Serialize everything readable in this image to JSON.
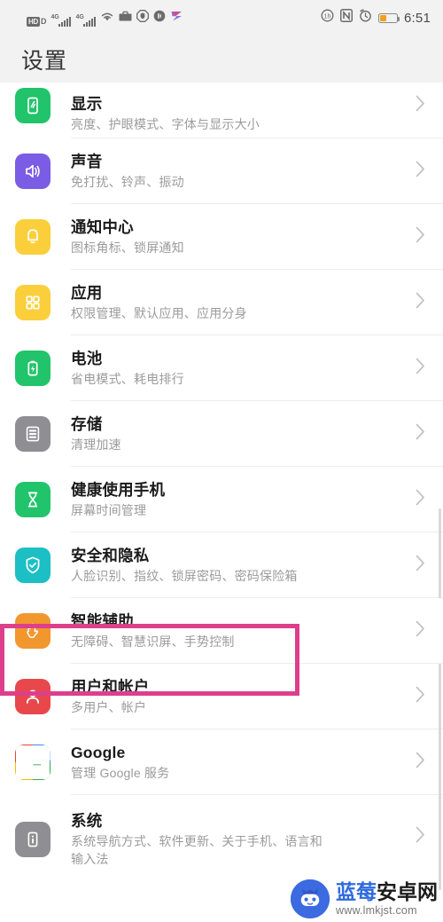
{
  "status_bar": {
    "hd_label": "HD",
    "hd_sub": "D",
    "network_1": "4G",
    "network_2": "4G",
    "icons_left": [
      "hd-voice-icon",
      "signal-4g-icon-1",
      "signal-4g-icon-2",
      "wifi-icon",
      "briefcase-icon",
      "shield-octagon-icon",
      "headphone-icon",
      "arrow-app-icon"
    ],
    "icons_right": [
      "sync-icon",
      "nfc-icon",
      "alarm-icon",
      "battery-icon"
    ],
    "battery_level": 38,
    "time": "6:51"
  },
  "header": {
    "title": "设置"
  },
  "settings_list": [
    {
      "title": "显示",
      "subtitle": "亮度、护眼模式、字体与显示大小",
      "icon": "display-icon",
      "icon_color": "#21c46a",
      "clipped": true,
      "highlighted": false
    },
    {
      "title": "声音",
      "subtitle": "免打扰、铃声、振动",
      "icon": "sound-icon",
      "icon_color": "#7b5ce5",
      "clipped": false,
      "highlighted": false
    },
    {
      "title": "通知中心",
      "subtitle": "图标角标、锁屏通知",
      "icon": "notification-bell-icon",
      "icon_color": "#fbcf3c",
      "clipped": false,
      "highlighted": false
    },
    {
      "title": "应用",
      "subtitle": "权限管理、默认应用、应用分身",
      "icon": "apps-grid-icon",
      "icon_color": "#fbcf3c",
      "clipped": false,
      "highlighted": false
    },
    {
      "title": "电池",
      "subtitle": "省电模式、耗电排行",
      "icon": "battery-icon",
      "icon_color": "#21c46a",
      "clipped": false,
      "highlighted": false
    },
    {
      "title": "存储",
      "subtitle": "清理加速",
      "icon": "storage-icon",
      "icon_color": "#8e8e93",
      "clipped": false,
      "highlighted": false
    },
    {
      "title": "健康使用手机",
      "subtitle": "屏幕时间管理",
      "icon": "hourglass-icon",
      "icon_color": "#21c46a",
      "clipped": false,
      "highlighted": false
    },
    {
      "title": "安全和隐私",
      "subtitle": "人脸识别、指纹、锁屏密码、密码保险箱",
      "icon": "shield-check-icon",
      "icon_color": "#1bbfc4",
      "clipped": false,
      "highlighted": false
    },
    {
      "title": "智能辅助",
      "subtitle": "无障碍、智慧识屏、手势控制",
      "icon": "hand-icon",
      "icon_color": "#f2962e",
      "clipped": false,
      "highlighted": true
    },
    {
      "title": "用户和帐户",
      "subtitle": "多用户、帐户",
      "icon": "user-account-icon",
      "icon_color": "#e8484b",
      "clipped": false,
      "highlighted": false
    },
    {
      "title": "Google",
      "subtitle": "管理 Google 服务",
      "icon": "google-icon",
      "icon_color": "#ffffff",
      "clipped": false,
      "highlighted": false
    },
    {
      "title": "系统",
      "subtitle": "系统导航方式、软件更新、关于手机、语言和\n输入法",
      "icon": "system-info-icon",
      "icon_color": "#8e8e93",
      "clipped": false,
      "highlighted": false
    }
  ],
  "highlight": {
    "color": "#dd3f8c",
    "target": "智能辅助"
  },
  "watermark": {
    "name_blue": "蓝莓",
    "name_dark": "安卓网",
    "url": "www.lmkjst.com",
    "logo": "android-robot-icon"
  }
}
